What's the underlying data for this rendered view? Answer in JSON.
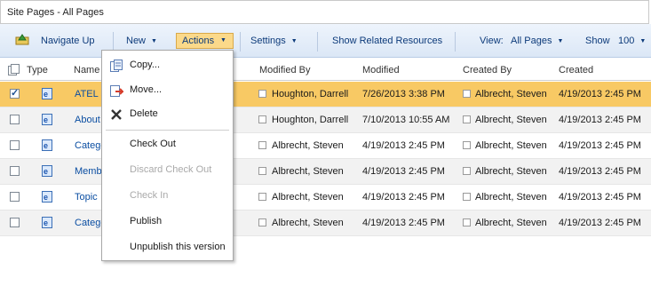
{
  "title": "Site Pages - All Pages",
  "toolbar": {
    "navigate_up": "Navigate Up",
    "new": "New",
    "actions": "Actions",
    "settings": "Settings",
    "show_related": "Show Related Resources",
    "view_label": "View:",
    "view_value": "All Pages",
    "show_label": "Show",
    "show_value": "100"
  },
  "columns": {
    "type": "Type",
    "name": "Name",
    "modified_by": "Modified By",
    "modified": "Modified",
    "created_by": "Created By",
    "created": "Created"
  },
  "rows": [
    {
      "name": "ATEL S",
      "modified_by": "Houghton, Darrell",
      "modified": "7/26/2013 3:38 PM",
      "created_by": "Albrecht, Steven",
      "created": "4/19/2013 2:45 PM",
      "selected": true
    },
    {
      "name": "About",
      "modified_by": "Houghton, Darrell",
      "modified": "7/10/2013 10:55 AM",
      "created_by": "Albrecht, Steven",
      "created": "4/19/2013 2:45 PM",
      "selected": false
    },
    {
      "name": "Catego",
      "modified_by": "Albrecht, Steven",
      "modified": "4/19/2013 2:45 PM",
      "created_by": "Albrecht, Steven",
      "created": "4/19/2013 2:45 PM",
      "selected": false
    },
    {
      "name": "Membe",
      "modified_by": "Albrecht, Steven",
      "modified": "4/19/2013 2:45 PM",
      "created_by": "Albrecht, Steven",
      "created": "4/19/2013 2:45 PM",
      "selected": false
    },
    {
      "name": "Topic",
      "modified_by": "Albrecht, Steven",
      "modified": "4/19/2013 2:45 PM",
      "created_by": "Albrecht, Steven",
      "created": "4/19/2013 2:45 PM",
      "selected": false
    },
    {
      "name": "Catego",
      "modified_by": "Albrecht, Steven",
      "modified": "4/19/2013 2:45 PM",
      "created_by": "Albrecht, Steven",
      "created": "4/19/2013 2:45 PM",
      "selected": false
    }
  ],
  "menu": {
    "items": [
      {
        "label": "Copy...",
        "icon": "copy-icon",
        "disabled": false
      },
      {
        "label": "Move...",
        "icon": "move-icon",
        "disabled": false
      },
      {
        "label": "Delete",
        "icon": "delete-icon",
        "disabled": false
      },
      {
        "label": "Check Out",
        "icon": "",
        "disabled": false
      },
      {
        "label": "Discard Check Out",
        "icon": "",
        "disabled": true
      },
      {
        "label": "Check In",
        "icon": "",
        "disabled": true
      },
      {
        "label": "Publish",
        "icon": "",
        "disabled": false
      },
      {
        "label": "Unpublish this version",
        "icon": "",
        "disabled": false
      }
    ]
  },
  "colors": {
    "selected_row": "#f8c964",
    "link": "#0b4ea2",
    "toolbar_text": "#0c3a7a",
    "actions_button": "#fbd98a"
  }
}
